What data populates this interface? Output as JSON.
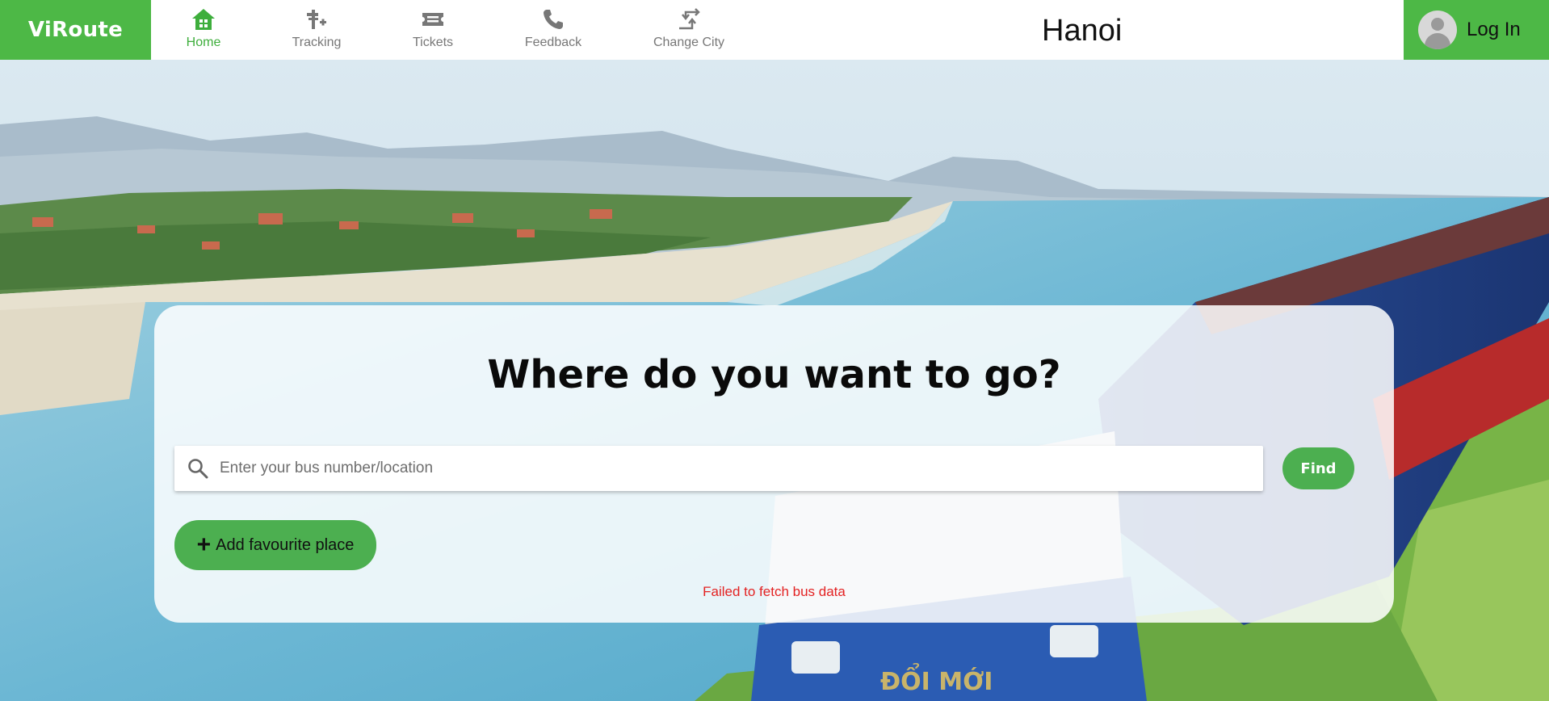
{
  "brand": {
    "name": "ViRoute",
    "color": "#4db846"
  },
  "nav": {
    "items": [
      {
        "label": "Home",
        "icon": "home-icon",
        "active": true
      },
      {
        "label": "Tracking",
        "icon": "tracking-icon",
        "active": false
      },
      {
        "label": "Tickets",
        "icon": "ticket-icon",
        "active": false
      },
      {
        "label": "Feedback",
        "icon": "phone-icon",
        "active": false
      },
      {
        "label": "Change City",
        "icon": "swap-arrows-icon",
        "active": false
      }
    ]
  },
  "header": {
    "city": "Hanoi",
    "login_label": "Log In"
  },
  "search": {
    "title": "Where do you want to go?",
    "placeholder": "Enter your bus number/location",
    "value": "",
    "find_label": "Find",
    "add_favourite_label": "Add favourite place",
    "error": "Failed to fetch bus data"
  },
  "colors": {
    "accent": "#4caf50",
    "error": "#e32222",
    "active_nav": "#3eae3c"
  }
}
